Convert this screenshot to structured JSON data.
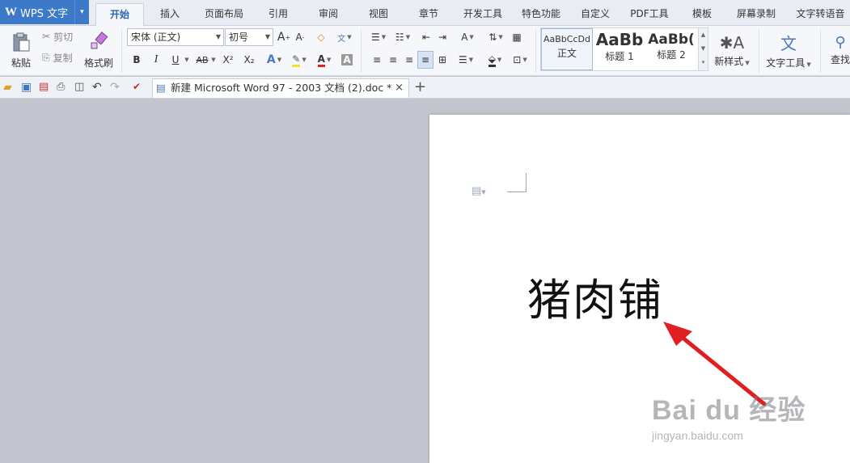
{
  "app": {
    "logo": "W",
    "title": "WPS 文字",
    "caret": "▾"
  },
  "menu_tabs": [
    {
      "label": "开始"
    },
    {
      "label": "插入"
    },
    {
      "label": "页面布局"
    },
    {
      "label": "引用"
    },
    {
      "label": "审阅"
    },
    {
      "label": "视图"
    },
    {
      "label": "章节"
    },
    {
      "label": "开发工具"
    },
    {
      "label": "特色功能"
    },
    {
      "label": "自定义"
    },
    {
      "label": "PDF工具"
    },
    {
      "label": "模板"
    },
    {
      "label": "屏幕录制"
    },
    {
      "label": "文字转语音"
    }
  ],
  "ribbon": {
    "paste": "粘贴",
    "cut": "剪切",
    "copy": "复制",
    "format_painter": "格式刷",
    "font_name": "宋体 (正文)",
    "font_size": "初号",
    "bold": "B",
    "italic": "I",
    "underline": "U",
    "strike": "AB",
    "superscript": "X²",
    "subscript": "X₂",
    "styles": [
      {
        "sample": "AaBbCcDd",
        "label": "正文"
      },
      {
        "sample": "AaBb",
        "label": "标题 1"
      },
      {
        "sample": "AaBb(",
        "label": "标题 2"
      }
    ],
    "new_style": "新样式",
    "text_tools": "文字工具",
    "find": "查找"
  },
  "document_tab": {
    "title": "新建 Microsoft Word 97 - 2003 文档 (2).doc *",
    "close": "×",
    "new": "+"
  },
  "document": {
    "text": "猪肉铺"
  },
  "watermark": {
    "brand": "Bai du 经验",
    "url": "jingyan.baidu.com"
  },
  "colors": {
    "accent": "#3c79c8",
    "arrow": "#e02020",
    "workspace": "#c2c5cd"
  }
}
